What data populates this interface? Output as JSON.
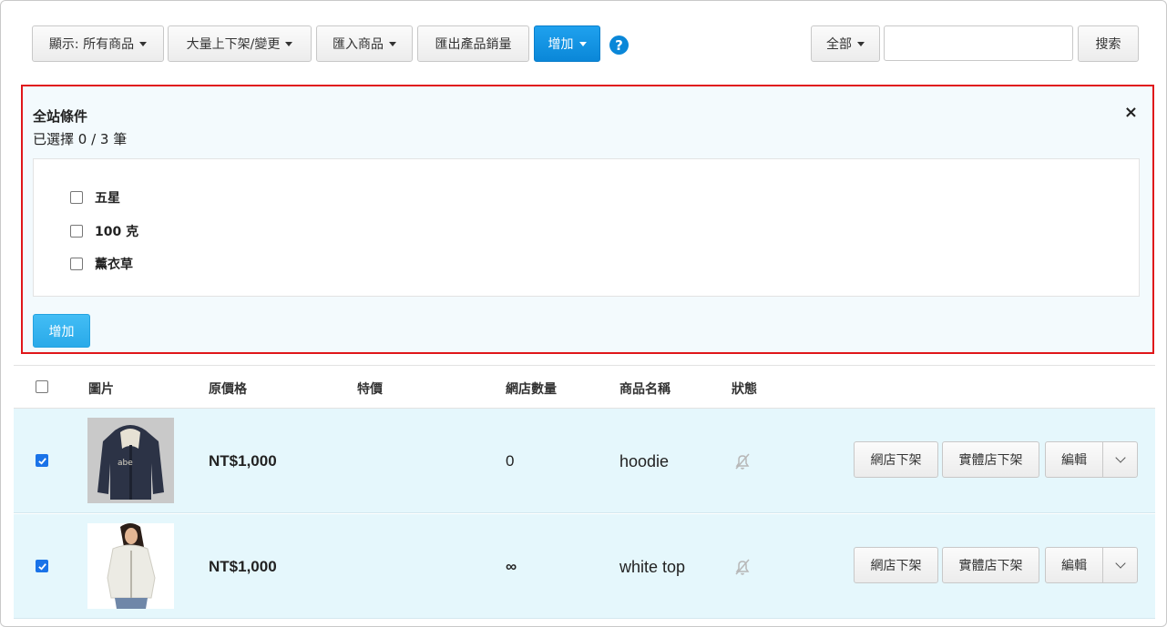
{
  "toolbar": {
    "display_label": "顯示: 所有商品",
    "bulk_label": "大量上下架/變更",
    "import_label": "匯入商品",
    "export_label": "匯出產品銷量",
    "add_label": "增加",
    "help_glyph": "?",
    "filter_label": "全部",
    "search_value": "",
    "search_button": "搜索"
  },
  "panel": {
    "title": "全站條件",
    "subtitle": "已選擇 0 / 3 筆",
    "close_glyph": "×",
    "options": [
      {
        "label": "五星",
        "checked": false
      },
      {
        "label": "100 克",
        "checked": false
      },
      {
        "label": "薰衣草",
        "checked": false
      }
    ],
    "add_button": "增加"
  },
  "table": {
    "headers": {
      "image": "圖片",
      "price": "原價格",
      "special": "特價",
      "stock": "網店數量",
      "name": "商品名稱",
      "status": "狀態"
    },
    "rows": [
      {
        "checked": true,
        "price": "NT$1,000",
        "special": "",
        "stock": "0",
        "name": "hoodie",
        "status_icon": "bell-off-icon",
        "actions": {
          "online_off": "網店下架",
          "store_off": "實體店下架",
          "edit": "編輯"
        }
      },
      {
        "checked": true,
        "price": "NT$1,000",
        "special": "",
        "stock": "∞",
        "name": "white top",
        "status_icon": "bell-off-icon",
        "actions": {
          "online_off": "網店下架",
          "store_off": "實體店下架",
          "edit": "編輯"
        }
      }
    ]
  },
  "colors": {
    "primary": "#0a87d8",
    "panel_border": "#e0161a",
    "panel_bg": "#f3fafd",
    "row_bg": "#e5f7fc",
    "checkbox": "#1a73e8"
  }
}
